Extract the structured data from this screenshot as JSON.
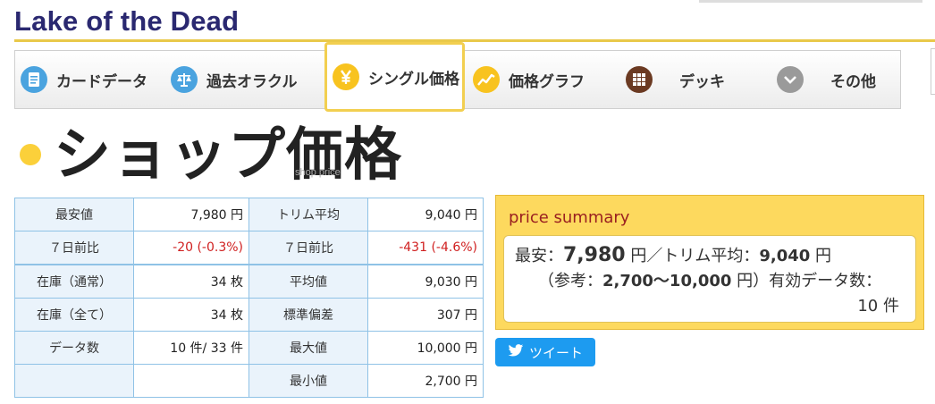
{
  "site": {
    "title": "Lake of the Dead"
  },
  "nav": {
    "tabs": [
      {
        "label": "カードデータ",
        "icon": "card-icon"
      },
      {
        "label": "過去オラクル",
        "icon": "scale-icon"
      },
      {
        "label": "シングル価格",
        "icon": "yen-icon",
        "active": true
      },
      {
        "label": "価格グラフ",
        "icon": "graph-icon"
      },
      {
        "label": "デッキ",
        "icon": "grid-icon"
      },
      {
        "label": "その他",
        "icon": "chevron-down-icon"
      }
    ]
  },
  "heading": {
    "text": "ショップ価格",
    "sub": "shop price"
  },
  "table1": [
    [
      "最安値",
      "7,980 円",
      "トリム平均",
      "9,040 円"
    ],
    [
      "７日前比",
      "-20 (-0.3%)",
      "７日前比",
      "-431 (-4.6%)"
    ]
  ],
  "table2": [
    [
      "在庫（通常）",
      "34 枚",
      "平均値",
      "9,030 円"
    ],
    [
      "在庫（全て）",
      "34 枚",
      "標準偏差",
      "307 円"
    ],
    [
      "データ数",
      "10 件/ 33 件",
      "最大値",
      "10,000 円"
    ],
    [
      "",
      "",
      "最小値",
      "2,700 円"
    ]
  ],
  "summary": {
    "title": "price summary",
    "l1_a": "最安：",
    "l1_b": "7,980",
    "l1_c": " 円／トリム平均：",
    "l1_d": "9,040",
    "l1_e": " 円",
    "l2_a": "（参考：",
    "l2_b": "2,700〜10,000",
    "l2_c": " 円）有効データ数：",
    "l3": "10 件"
  },
  "tweet": {
    "label": "ツイート"
  },
  "colors": {
    "accent": "#f2cf50",
    "title": "#2a2870",
    "negative": "#d02020",
    "twitter": "#1d9bf0"
  }
}
